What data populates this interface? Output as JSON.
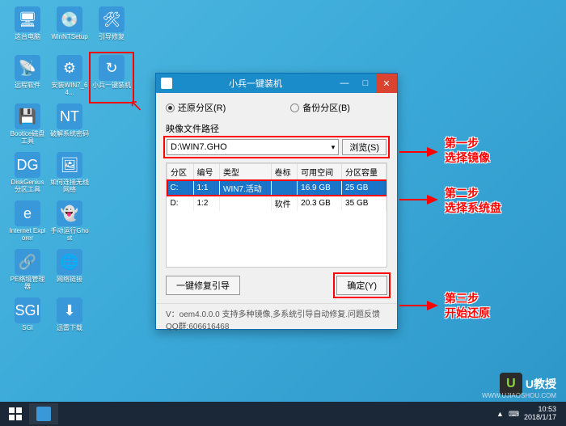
{
  "desktop": {
    "icons": [
      {
        "label": "这台电脑",
        "glyph": "🖥"
      },
      {
        "label": "WinNTSetup",
        "glyph": "💿"
      },
      {
        "label": "引导修复",
        "glyph": "🛠"
      },
      {
        "label": "远程软件",
        "glyph": "📡"
      },
      {
        "label": "安装WIN7_64...",
        "glyph": "⚙"
      },
      {
        "label": "小兵一键装机",
        "glyph": "↻",
        "highlighted": true
      },
      {
        "label": "Bootice磁盘工具",
        "glyph": "💾"
      },
      {
        "label": "破解系统密码",
        "glyph": "NT"
      },
      {
        "label": "",
        "glyph": ""
      },
      {
        "label": "DiskGenius分区工具",
        "glyph": "DG"
      },
      {
        "label": "如何连接无线网络",
        "glyph": "🖼"
      },
      {
        "label": "",
        "glyph": ""
      },
      {
        "label": "Internet Explorer",
        "glyph": "e"
      },
      {
        "label": "手动运行Ghost",
        "glyph": "👻"
      },
      {
        "label": "",
        "glyph": ""
      },
      {
        "label": "PE络境管理器",
        "glyph": "🔗"
      },
      {
        "label": "网络链接",
        "glyph": "🌐"
      },
      {
        "label": "",
        "glyph": ""
      },
      {
        "label": "SGI",
        "glyph": "SGI"
      },
      {
        "label": "迅雷下载",
        "glyph": "⬇"
      }
    ]
  },
  "window": {
    "title": "小兵一键装机",
    "radio_restore": "还原分区(R)",
    "radio_backup": "备份分区(B)",
    "path_label": "映像文件路径",
    "path_value": "D:\\WIN7.GHO",
    "browse": "浏览(S)",
    "table": {
      "headers": [
        "分区",
        "编号",
        "类型",
        "卷标",
        "可用空间",
        "分区容量"
      ],
      "rows": [
        {
          "cells": [
            "C:",
            "1:1",
            "WIN7.活动",
            "",
            "16.9 GB",
            "25 GB"
          ],
          "selected": true
        },
        {
          "cells": [
            "D:",
            "1:2",
            "",
            "软件",
            "20.3 GB",
            "35 GB"
          ],
          "selected": false
        }
      ]
    },
    "repair_btn": "一键修复引导",
    "ok_btn": "确定(Y)",
    "status": "V：oem4.0.0.0      支持多种镜像,多系统引导自动修复.问题反馈QQ群:606616468"
  },
  "annotations": {
    "step1_title": "第一步",
    "step1_text": "选择镜像",
    "step2_title": "第二步",
    "step2_text": "选择系统盘",
    "step3_title": "第三步",
    "step3_text": "开始还原"
  },
  "taskbar": {
    "time": "10:53",
    "date": "2018/1/17"
  },
  "watermark": {
    "glyph": "U",
    "text": "U教授",
    "sub": "WWW.UJIAOSHOU.COM"
  }
}
